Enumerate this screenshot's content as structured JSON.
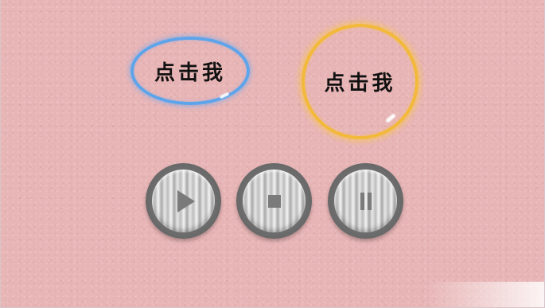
{
  "buttons": {
    "oval": {
      "label": "点击我",
      "border_color": "#5ea4ea"
    },
    "circle": {
      "label": "点击我",
      "border_color": "#f2b93a"
    }
  },
  "media_controls": [
    {
      "icon": "play-icon"
    },
    {
      "icon": "stop-icon"
    },
    {
      "icon": "pause-icon"
    }
  ],
  "colors": {
    "background": "#e8b5b6",
    "media_icon": "#7b7b7b"
  }
}
